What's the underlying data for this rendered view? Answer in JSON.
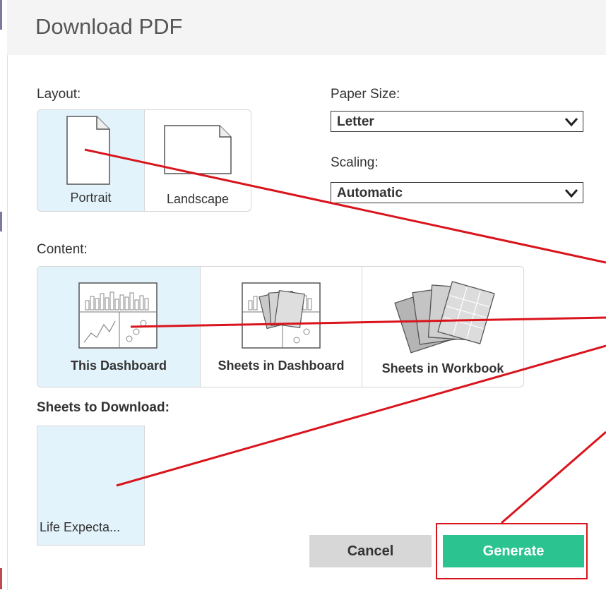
{
  "dialog": {
    "title": "Download PDF",
    "layout_label": "Layout:",
    "layout_options": [
      {
        "label": "Portrait",
        "selected": true
      },
      {
        "label": "Landscape",
        "selected": false
      }
    ],
    "paper_size_label": "Paper Size:",
    "paper_size_value": "Letter",
    "scaling_label": "Scaling:",
    "scaling_value": "Automatic",
    "content_label": "Content:",
    "content_options": [
      {
        "label": "This Dashboard",
        "selected": true
      },
      {
        "label": "Sheets in Dashboard",
        "selected": false
      },
      {
        "label": "Sheets in Workbook",
        "selected": false
      }
    ],
    "sheets_label": "Sheets to Download:",
    "sheets": [
      {
        "label": "Life Expecta...",
        "selected": true
      }
    ],
    "cancel_label": "Cancel",
    "generate_label": "Generate"
  },
  "colors": {
    "selected_bg": "#e3f3fb",
    "generate_bg": "#2bc38f",
    "cancel_bg": "#d7d7d7",
    "annotation_red": "#d9141c"
  },
  "icons": [
    "portrait-page-icon",
    "landscape-page-icon",
    "dashboard-icon",
    "sheets-in-dashboard-icon",
    "sheets-in-workbook-icon",
    "chevron-down-icon"
  ]
}
